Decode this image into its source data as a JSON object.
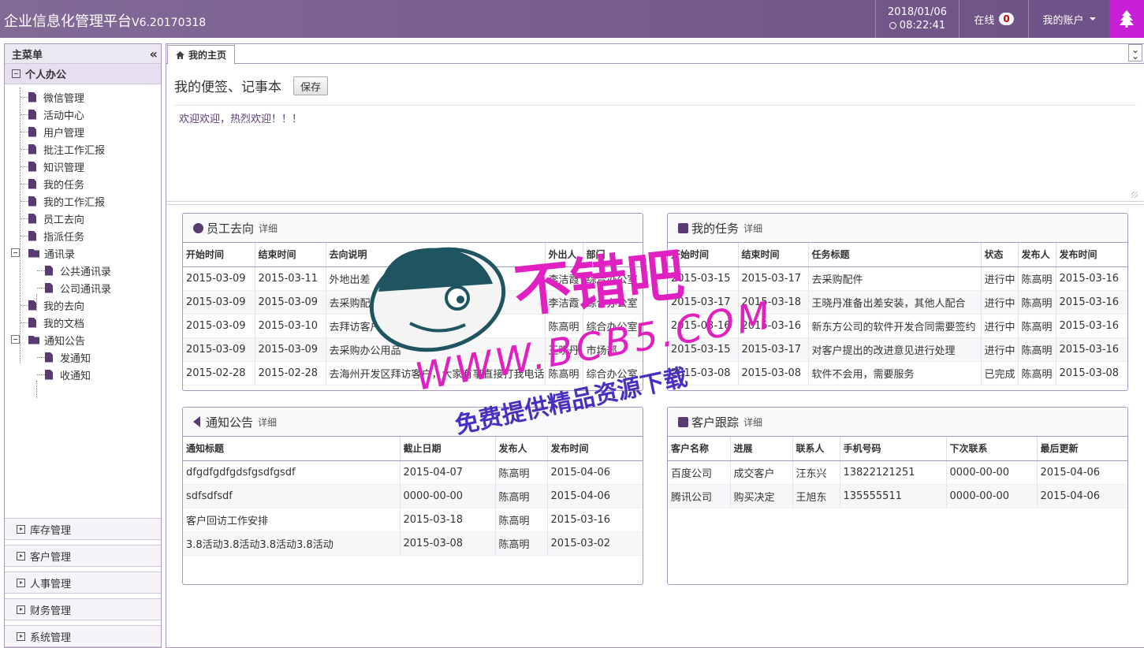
{
  "header": {
    "app_title": "企业信息化管理平台",
    "version": "V6.20170318",
    "date": "2018/01/06",
    "time": "08:22:41",
    "online_label": "在线",
    "online_count": "0",
    "account_label": "我的账户",
    "colors": {
      "bar": "#7c6394",
      "accent": "#c820d6"
    }
  },
  "sidebar": {
    "title": "主菜单",
    "collapse_icon": "double-chevron-left-icon",
    "active_group": "个人办公",
    "items": [
      {
        "label": "微信管理"
      },
      {
        "label": "活动中心"
      },
      {
        "label": "用户管理"
      },
      {
        "label": "批注工作汇报"
      },
      {
        "label": "知识管理"
      },
      {
        "label": "我的任务"
      },
      {
        "label": "我的工作汇报"
      },
      {
        "label": "员工去向"
      },
      {
        "label": "指派任务"
      },
      {
        "label": "通讯录"
      },
      {
        "label": "公共通讯录"
      },
      {
        "label": "公司通讯录"
      },
      {
        "label": "我的去向"
      },
      {
        "label": "我的文档"
      },
      {
        "label": "通知公告"
      },
      {
        "label": "发通知"
      },
      {
        "label": "收通知"
      }
    ],
    "groups": [
      {
        "label": "库存管理"
      },
      {
        "label": "客户管理"
      },
      {
        "label": "人事管理"
      },
      {
        "label": "财务管理"
      },
      {
        "label": "系统管理"
      }
    ]
  },
  "tabs": {
    "home": "我的主页"
  },
  "memo": {
    "title": "我的便签、记事本",
    "save_label": "保存",
    "content": "欢迎欢迎，热烈欢迎！！！"
  },
  "detail_label": "详细",
  "panels": {
    "whereabouts": {
      "title": "员工去向",
      "columns": [
        "开始时间",
        "结束时间",
        "去向说明",
        "外出人",
        "部门"
      ],
      "rows": [
        [
          "2015-03-09",
          "2015-03-11",
          "外地出差",
          "李洁霞",
          "综合办公室"
        ],
        [
          "2015-03-09",
          "2015-03-09",
          "去采购配件",
          "李洁霞",
          "综合办公室"
        ],
        [
          "2015-03-09",
          "2015-03-10",
          "去拜访客户",
          "陈高明",
          "综合办公室"
        ],
        [
          "2015-03-09",
          "2015-03-09",
          "去采购办公用品",
          "王晓丹",
          "市场部"
        ],
        [
          "2015-02-28",
          "2015-02-28",
          "去海州开发区拜访客户，大家有事直接打我电话",
          "陈高明",
          "综合办公室"
        ]
      ]
    },
    "tasks": {
      "title": "我的任务",
      "columns": [
        "开始时间",
        "结束时间",
        "任务标题",
        "状态",
        "发布人",
        "发布时间"
      ],
      "rows": [
        [
          "2015-03-15",
          "2015-03-17",
          "去采购配件",
          "进行中",
          "陈高明",
          "2015-03-16"
        ],
        [
          "2015-03-17",
          "2015-03-18",
          "王晓丹准备出差安装，其他人配合",
          "进行中",
          "陈高明",
          "2015-03-16"
        ],
        [
          "2015-03-16",
          "2015-03-16",
          "新东方公司的软件开发合同需要签约",
          "进行中",
          "陈高明",
          "2015-03-16"
        ],
        [
          "2015-03-15",
          "2015-03-17",
          "对客户提出的改进意见进行处理",
          "进行中",
          "陈高明",
          "2015-03-16"
        ],
        [
          "2015-03-08",
          "2015-03-08",
          "软件不会用，需要服务",
          "已完成",
          "陈高明",
          "2015-03-08"
        ]
      ]
    },
    "notices": {
      "title": "通知公告",
      "columns": [
        "通知标题",
        "截止日期",
        "发布人",
        "发布时间"
      ],
      "rows": [
        [
          "dfgdfgdfgdsfgsdfgsdf",
          "2015-04-07",
          "陈高明",
          "2015-04-06"
        ],
        [
          "sdfsdfsdf",
          "0000-00-00",
          "陈高明",
          "2015-04-06"
        ],
        [
          "客户回访工作安排",
          "2015-03-18",
          "陈高明",
          "2015-03-16"
        ],
        [
          "3.8活动3.8活动3.8活动3.8活动",
          "2015-03-08",
          "陈高明",
          "2015-03-02"
        ]
      ]
    },
    "customers": {
      "title": "客户跟踪",
      "columns": [
        "客户名称",
        "进展",
        "联系人",
        "手机号码",
        "下次联系",
        "最后更新"
      ],
      "rows": [
        [
          "百度公司",
          "成交客户",
          "汪东兴",
          "13822121251",
          "0000-00-00",
          "2015-04-06"
        ],
        [
          "腾讯公司",
          "购买决定",
          "王旭东",
          "135555511",
          "0000-00-00",
          "2015-04-06"
        ]
      ]
    }
  },
  "watermark": {
    "line1": "不错吧",
    "line2": "WWW.BCB5.COM",
    "line3": "免费提供精品资源下载",
    "color": "#e020c0"
  }
}
